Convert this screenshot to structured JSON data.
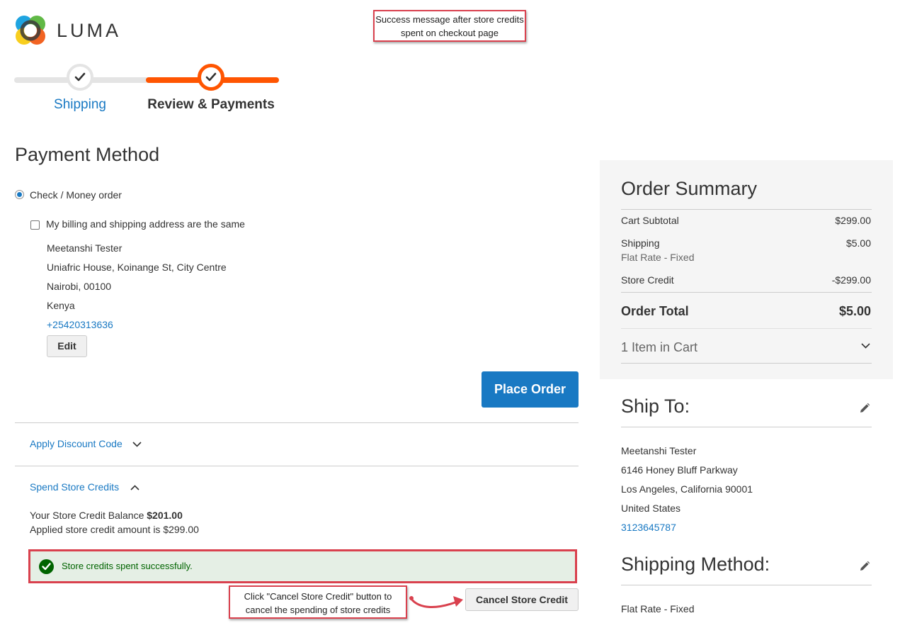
{
  "brand": {
    "name": "LUMA"
  },
  "annotations": {
    "top": "Success message after store credits spent on checkout page",
    "bottom": "Click \"Cancel Store Credit\" button to cancel the spending of store credits"
  },
  "progress": {
    "steps": [
      {
        "label": "Shipping",
        "state": "complete"
      },
      {
        "label": "Review & Payments",
        "state": "active"
      }
    ]
  },
  "payment": {
    "title": "Payment Method",
    "method_label": "Check / Money order",
    "same_address_label": "My billing and shipping address are the same",
    "address": {
      "name": "Meetanshi Tester",
      "street": "Uniafric House, Koinange St, City Centre",
      "city": "Nairobi, 00100",
      "country": "Kenya",
      "phone": "+25420313636"
    },
    "edit_label": "Edit",
    "place_order_label": "Place Order"
  },
  "discount": {
    "label": "Apply Discount Code"
  },
  "store_credit": {
    "label": "Spend Store Credits",
    "balance_label": "Your Store Credit Balance",
    "balance_value": "$201.00",
    "applied_text": "Applied store credit amount is $299.00",
    "success_message": "Store credits spent successfully.",
    "cancel_label": "Cancel Store Credit"
  },
  "summary": {
    "title": "Order Summary",
    "rows": [
      {
        "label": "Cart Subtotal",
        "value": "$299.00"
      },
      {
        "label": "Shipping",
        "sub": "Flat Rate - Fixed",
        "value": "$5.00"
      },
      {
        "label": "Store Credit",
        "value": "-$299.00"
      }
    ],
    "total_label": "Order Total",
    "total_value": "$5.00",
    "items_label": "1 Item in Cart"
  },
  "ship_to": {
    "title": "Ship To:",
    "name": "Meetanshi Tester",
    "street": "6146 Honey Bluff Parkway",
    "city": "Los Angeles, California 90001",
    "country": "United States",
    "phone": "3123645787"
  },
  "shipping_method": {
    "title": "Shipping Method:",
    "value": "Flat Rate - Fixed"
  },
  "colors": {
    "accent_orange": "#ff5501",
    "link_blue": "#1979c3",
    "annotation_red": "#d9414e",
    "success_green": "#006400"
  }
}
